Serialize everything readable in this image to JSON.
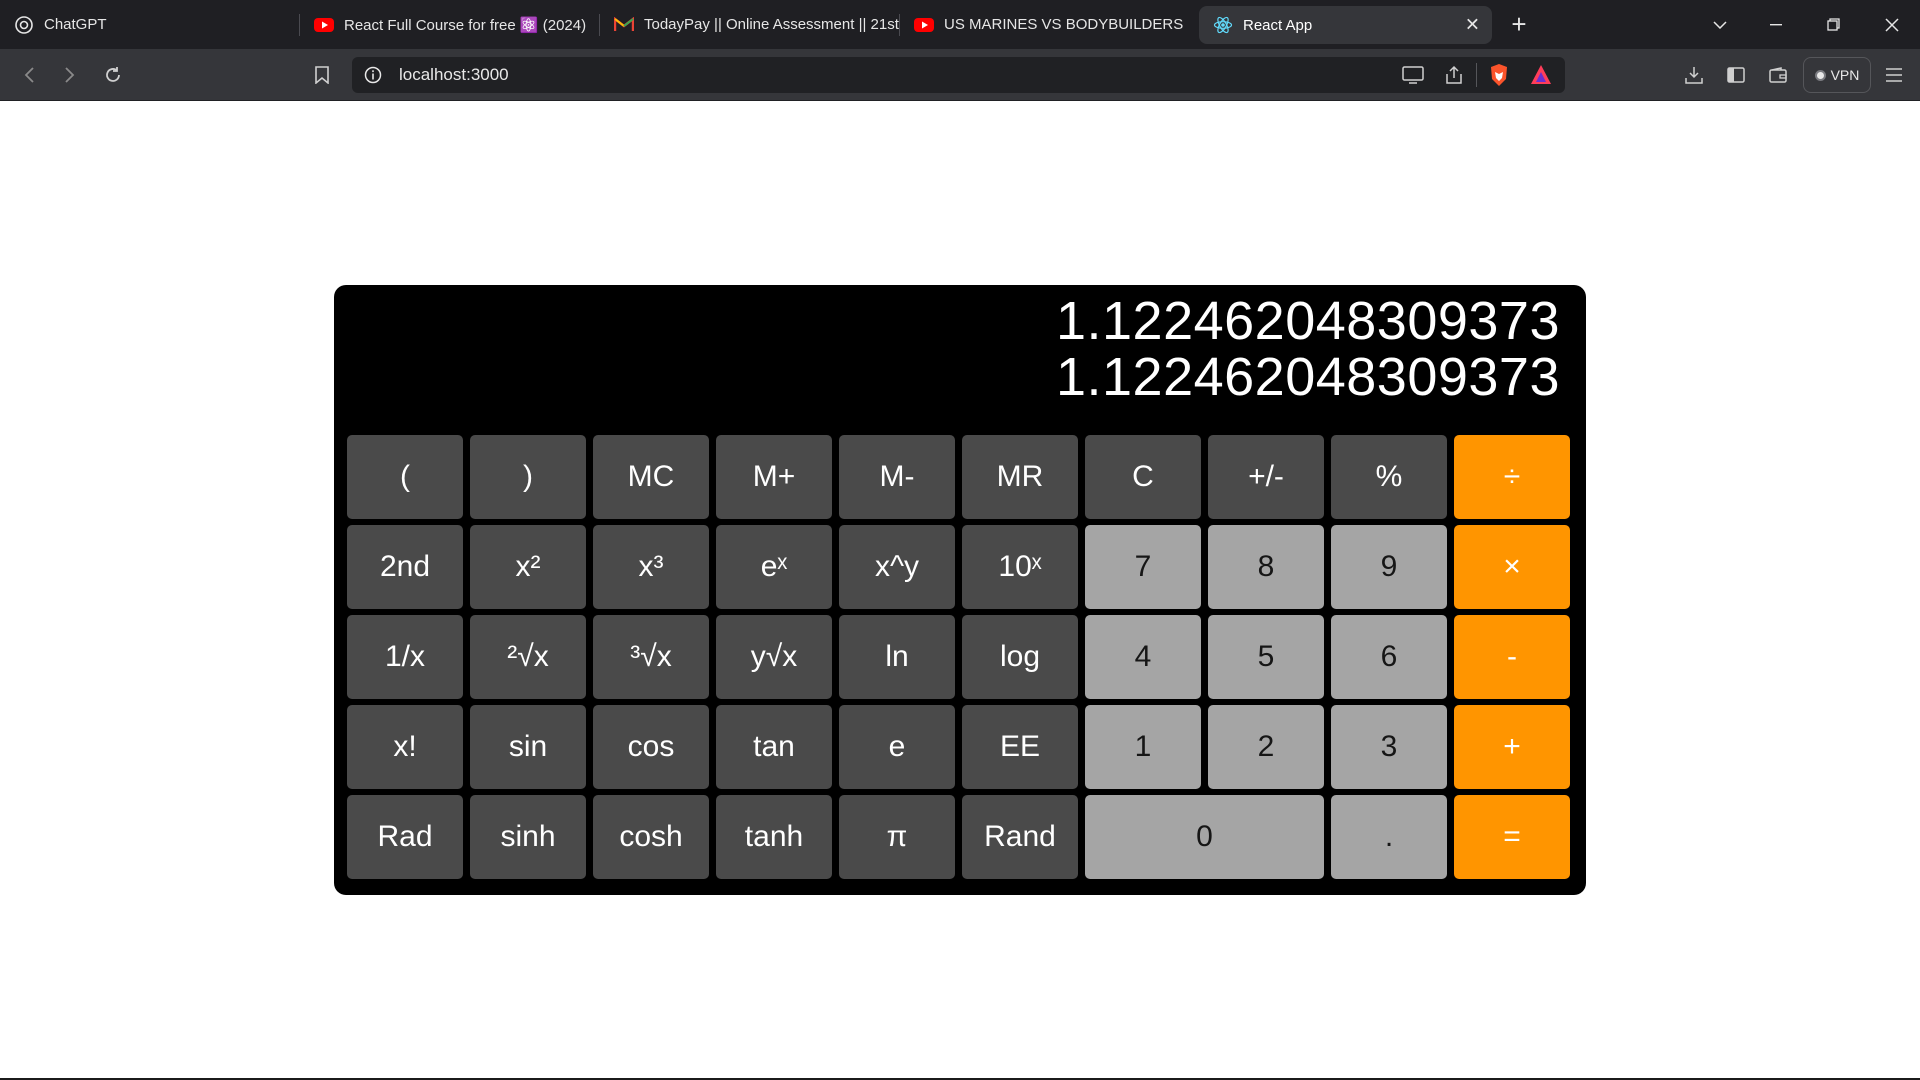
{
  "browser": {
    "tabs": [
      {
        "title": "ChatGPT",
        "icon": "chatgpt-icon"
      },
      {
        "title": "React Full Course for free ⚛️ (2024)",
        "icon": "youtube-icon"
      },
      {
        "title": "TodayPay || Online Assessment || 21st",
        "icon": "gmail-icon"
      },
      {
        "title": "US MARINES VS BODYBUILDERS (WHO IS",
        "icon": "youtube-icon"
      },
      {
        "title": "React App",
        "icon": "react-icon",
        "active": true
      }
    ],
    "url": "localhost:3000",
    "vpn_label": "VPN"
  },
  "calculator": {
    "display_expression": "1.122462048309373",
    "display_result": "1.122462048309373",
    "colors": {
      "function_key": "#4a4a4a",
      "number_key": "#a5a5a5",
      "operator_key": "#ff9500",
      "body": "#000000"
    },
    "rows": [
      [
        "(",
        ")",
        "MC",
        "M+",
        "M-",
        "MR",
        "C",
        "+/-",
        "%",
        "÷"
      ],
      [
        "2nd",
        "x²",
        "x³",
        "eˣ",
        "x^y",
        "10ˣ",
        "7",
        "8",
        "9",
        "×"
      ],
      [
        "1/x",
        "²√x",
        "³√x",
        "y√x",
        "ln",
        "log",
        "4",
        "5",
        "6",
        "-"
      ],
      [
        "x!",
        "sin",
        "cos",
        "tan",
        "e",
        "EE",
        "1",
        "2",
        "3",
        "+"
      ],
      [
        "Rad",
        "sinh",
        "cosh",
        "tanh",
        "π",
        "Rand",
        "0",
        ".",
        "="
      ]
    ]
  }
}
